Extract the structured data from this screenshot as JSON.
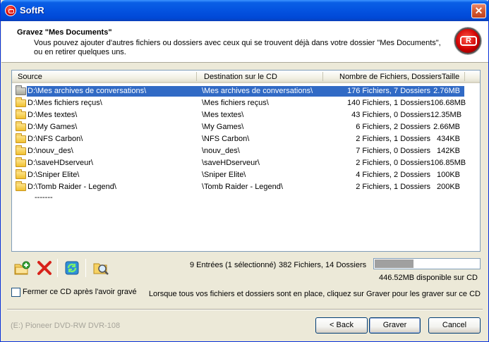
{
  "window": {
    "title": "SoftR",
    "close_label": "✕"
  },
  "header": {
    "title": "Gravez \"Mes Documents\"",
    "description": "Vous pouvez ajouter d'autres fichiers ou dossiers avec ceux qui se trouvent déjà dans votre dossier \"Mes Documents\", ou en retirer quelques uns.",
    "logo_letter": "R"
  },
  "columns": {
    "source": "Source",
    "destination": "Destination sur le CD",
    "count": "Nombre de Fichiers, Dossiers",
    "size": "Taille"
  },
  "rows": [
    {
      "source": "D:\\Mes archives de conversations\\",
      "dest": "\\Mes archives de conversations\\",
      "count": "176 Fichiers, 7 Dossiers",
      "size": "2.76MB"
    },
    {
      "source": "D:\\Mes fichiers reçus\\",
      "dest": "\\Mes fichiers reçus\\",
      "count": "140 Fichiers, 1 Dossiers",
      "size": "106.68MB"
    },
    {
      "source": "D:\\Mes textes\\",
      "dest": "\\Mes textes\\",
      "count": "43 Fichiers, 0 Dossiers",
      "size": "12.35MB"
    },
    {
      "source": "D:\\My Games\\",
      "dest": "\\My Games\\",
      "count": "6 Fichiers, 2 Dossiers",
      "size": "2.66MB"
    },
    {
      "source": "D:\\NFS Carbon\\",
      "dest": "\\NFS Carbon\\",
      "count": "2 Fichiers, 1 Dossiers",
      "size": "434KB"
    },
    {
      "source": "D:\\nouv_des\\",
      "dest": "\\nouv_des\\",
      "count": "7 Fichiers, 0 Dossiers",
      "size": "142KB"
    },
    {
      "source": "D:\\saveHDserveur\\",
      "dest": "\\saveHDserveur\\",
      "count": "2 Fichiers, 0 Dossiers",
      "size": "106.85MB"
    },
    {
      "source": "D:\\Sniper Elite\\",
      "dest": "\\Sniper Elite\\",
      "count": "4 Fichiers, 2 Dossiers",
      "size": "100KB"
    },
    {
      "source": "D:\\Tomb Raider - Legend\\",
      "dest": "\\Tomb Raider - Legend\\",
      "count": "2 Fichiers, 1 Dossiers",
      "size": "200KB"
    }
  ],
  "list_ellipsis": "-------",
  "toolbar": {
    "add_icon": "add-folder-icon",
    "remove_icon": "delete-x-icon",
    "refresh_icon": "refresh-icon",
    "browse_icon": "browse-folder-icon"
  },
  "status": {
    "entries": "9 Entrées (1 sélectionné)",
    "totals": "382 Fichiers, 14 Dossiers",
    "free_space": "446.52MB disponible sur CD",
    "disc_usage_fraction": 0.37
  },
  "options": {
    "eject_label": "Fermer ce CD après l'avoir gravé",
    "eject_checked": false
  },
  "hint": "Lorsque tous vos fichiers et dossiers sont en place, cliquez sur Graver pour les graver sur ce CD",
  "drive": "(E:) Pioneer DVD-RW  DVR-108",
  "buttons": {
    "back": "< Back",
    "burn": "Graver",
    "cancel": "Cancel"
  },
  "colors": {
    "selection": "#316ac5",
    "titlebar": "#0453e0",
    "accent_red": "#d00000"
  }
}
